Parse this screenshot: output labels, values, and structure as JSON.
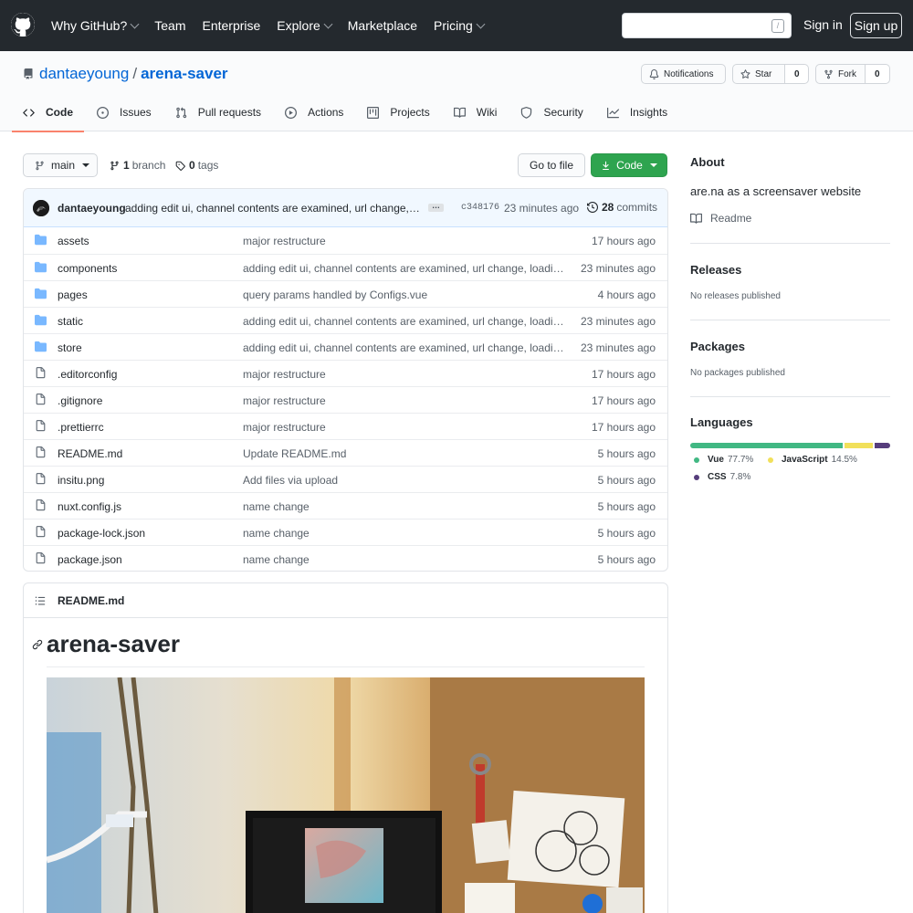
{
  "header": {
    "nav": [
      {
        "label": "Why GitHub?",
        "caret": true
      },
      {
        "label": "Team",
        "caret": false
      },
      {
        "label": "Enterprise",
        "caret": false
      },
      {
        "label": "Explore",
        "caret": true
      },
      {
        "label": "Marketplace",
        "caret": false
      },
      {
        "label": "Pricing",
        "caret": true
      }
    ],
    "search_value": "",
    "search_shortcut": "/",
    "signin_label": "Sign in",
    "signup_label": "Sign up"
  },
  "repo": {
    "owner": "dantaeyoung",
    "separator": "/",
    "name": "arena-saver",
    "notifications_label": "Notifications",
    "star_label": "Star",
    "star_count": "0",
    "fork_label": "Fork",
    "fork_count": "0"
  },
  "tabs": [
    {
      "label": "Code",
      "icon": "code-icon",
      "selected": true
    },
    {
      "label": "Issues",
      "icon": "issue-icon",
      "selected": false
    },
    {
      "label": "Pull requests",
      "icon": "pull-request-icon",
      "selected": false
    },
    {
      "label": "Actions",
      "icon": "play-icon",
      "selected": false
    },
    {
      "label": "Projects",
      "icon": "project-icon",
      "selected": false
    },
    {
      "label": "Wiki",
      "icon": "book-icon",
      "selected": false
    },
    {
      "label": "Security",
      "icon": "shield-icon",
      "selected": false
    },
    {
      "label": "Insights",
      "icon": "graph-icon",
      "selected": false
    }
  ],
  "toolbar": {
    "branch_name": "main",
    "branch_count": "1",
    "branch_label": "branch",
    "tag_count": "0",
    "tag_label": "tags",
    "goto_label": "Go to file",
    "code_label": "Code"
  },
  "commit": {
    "author": "dantaeyoung",
    "message": "adding edit ui, channel contents are examined, url change, loading screen",
    "ellipsis": "…",
    "sha": "c348176",
    "time": "23 minutes ago",
    "count": "28",
    "count_label": "commits"
  },
  "files": [
    {
      "type": "dir",
      "name": "assets",
      "message": "major restructure",
      "age": "17 hours ago"
    },
    {
      "type": "dir",
      "name": "components",
      "message": "adding edit ui, channel contents are examined, url change, loading screen",
      "age": "23 minutes ago"
    },
    {
      "type": "dir",
      "name": "pages",
      "message": "query params handled by Configs.vue",
      "age": "4 hours ago"
    },
    {
      "type": "dir",
      "name": "static",
      "message": "adding edit ui, channel contents are examined, url change, loading screen",
      "age": "23 minutes ago"
    },
    {
      "type": "dir",
      "name": "store",
      "message": "adding edit ui, channel contents are examined, url change, loading screen",
      "age": "23 minutes ago"
    },
    {
      "type": "file",
      "name": ".editorconfig",
      "message": "major restructure",
      "age": "17 hours ago"
    },
    {
      "type": "file",
      "name": ".gitignore",
      "message": "major restructure",
      "age": "17 hours ago"
    },
    {
      "type": "file",
      "name": ".prettierrc",
      "message": "major restructure",
      "age": "17 hours ago"
    },
    {
      "type": "file",
      "name": "README.md",
      "message": "Update README.md",
      "age": "5 hours ago"
    },
    {
      "type": "file",
      "name": "insitu.png",
      "message": "Add files via upload",
      "age": "5 hours ago"
    },
    {
      "type": "file",
      "name": "nuxt.config.js",
      "message": "name change",
      "age": "5 hours ago"
    },
    {
      "type": "file",
      "name": "package-lock.json",
      "message": "name change",
      "age": "5 hours ago"
    },
    {
      "type": "file",
      "name": "package.json",
      "message": "name change",
      "age": "5 hours ago"
    }
  ],
  "readme": {
    "filename": "README.md",
    "heading": "arena-saver"
  },
  "about": {
    "title": "About",
    "description": "are.na as a screensaver website",
    "readme_label": "Readme"
  },
  "releases": {
    "title": "Releases",
    "empty": "No releases published"
  },
  "packages": {
    "title": "Packages",
    "empty": "No packages published"
  },
  "languages": {
    "title": "Languages",
    "items": [
      {
        "name": "Vue",
        "percent": "77.7%",
        "value": 77.7,
        "color": "#2c3e50_x"
      },
      {
        "name": "JavaScript",
        "percent": "14.5%",
        "value": 14.5,
        "color": "#f1e05a"
      },
      {
        "name": "CSS",
        "percent": "7.8%",
        "value": 7.8,
        "color": "#563d7c"
      }
    ]
  },
  "colors": {
    "header_bg": "#24292e",
    "link": "#0366d6",
    "primary_button": "#2ea44f",
    "selected_tab_underline": "#f9826c",
    "vue": "#41b883"
  }
}
